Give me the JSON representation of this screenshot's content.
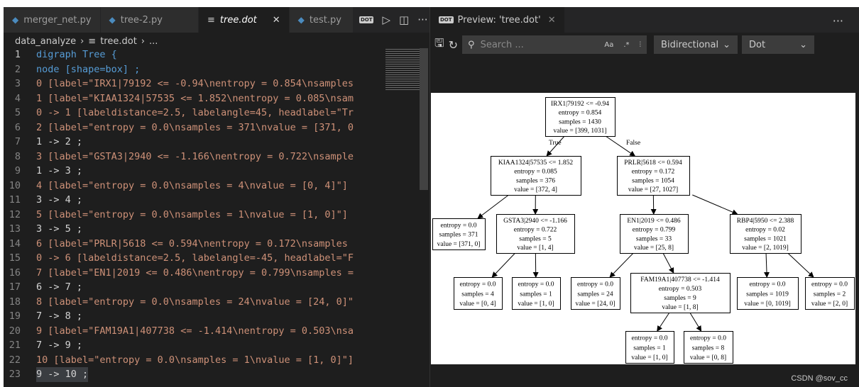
{
  "editor": {
    "tabs": [
      {
        "label": "merger_net.py",
        "icon": "python-icon"
      },
      {
        "label": "tree-2.py",
        "icon": "python-icon"
      },
      {
        "label": "tree.dot",
        "icon": "file-lines-icon",
        "active": true,
        "close": "✕"
      },
      {
        "label": "test.py",
        "icon": "python-icon"
      }
    ],
    "actions": {
      "dot_badge": "DOT",
      "run": "▷",
      "split": "◫",
      "more": "···"
    },
    "breadcrumb": [
      "data_analyze",
      "tree.dot",
      "..."
    ],
    "lines": [
      "digraph Tree {",
      "node [shape=box] ;",
      "0 [label=\"IRX1|79192 <= -0.94\\nentropy = 0.854\\nsamples",
      "1 [label=\"KIAA1324|57535 <= 1.852\\nentropy = 0.085\\nsam",
      "0 -> 1 [labeldistance=2.5, labelangle=45, headlabel=\"Tr",
      "2 [label=\"entropy = 0.0\\nsamples = 371\\nvalue = [371, 0",
      "1 -> 2 ;",
      "3 [label=\"GSTA3|2940 <= -1.166\\nentropy = 0.722\\nsample",
      "1 -> 3 ;",
      "4 [label=\"entropy = 0.0\\nsamples = 4\\nvalue = [0, 4]\"]",
      "3 -> 4 ;",
      "5 [label=\"entropy = 0.0\\nsamples = 1\\nvalue = [1, 0]\"]",
      "3 -> 5 ;",
      "6 [label=\"PRLR|5618 <= 0.594\\nentropy = 0.172\\nsamples",
      "0 -> 6 [labeldistance=2.5, labelangle=-45, headlabel=\"F",
      "7 [label=\"EN1|2019 <= 0.486\\nentropy = 0.799\\nsamples =",
      "6 -> 7 ;",
      "8 [label=\"entropy = 0.0\\nsamples = 24\\nvalue = [24, 0]\"",
      "7 -> 8 ;",
      "9 [label=\"FAM19A1|407738 <= -1.414\\nentropy = 0.503\\nsa",
      "7 -> 9 ;",
      "10 [label=\"entropy = 0.0\\nsamples = 1\\nvalue = [1, 0]\"]",
      "9 -> 10 ;"
    ]
  },
  "preview": {
    "tab_label": "Preview: 'tree.dot'",
    "close": "✕",
    "more": "···",
    "search_placeholder": "Search ...",
    "search_options": [
      "Aa",
      ".*",
      "⫶"
    ],
    "direction": "Bidirectional",
    "engine": "Dot",
    "edge_labels": {
      "true": "True",
      "false": "False"
    },
    "nodes": [
      {
        "id": 0,
        "lines": [
          "IRX1|79192 <= -0.94",
          "entropy = 0.854",
          "samples = 1430",
          "value = [399, 1031]"
        ]
      },
      {
        "id": 1,
        "lines": [
          "KIAA1324|57535 <= 1.852",
          "entropy = 0.085",
          "samples = 376",
          "value = [372, 4]"
        ]
      },
      {
        "id": 2,
        "lines": [
          "entropy = 0.0",
          "samples = 371",
          "value = [371, 0]"
        ]
      },
      {
        "id": 3,
        "lines": [
          "GSTA3|2940 <= -1.166",
          "entropy = 0.722",
          "samples = 5",
          "value = [1, 4]"
        ]
      },
      {
        "id": 4,
        "lines": [
          "entropy = 0.0",
          "samples = 4",
          "value = [0, 4]"
        ]
      },
      {
        "id": 5,
        "lines": [
          "entropy = 0.0",
          "samples = 1",
          "value = [1, 0]"
        ]
      },
      {
        "id": 6,
        "lines": [
          "PRLR|5618 <= 0.594",
          "entropy = 0.172",
          "samples = 1054",
          "value = [27, 1027]"
        ]
      },
      {
        "id": 7,
        "lines": [
          "EN1|2019 <= 0.486",
          "entropy = 0.799",
          "samples = 33",
          "value = [25, 8]"
        ]
      },
      {
        "id": 8,
        "lines": [
          "entropy = 0.0",
          "samples = 24",
          "value = [24, 0]"
        ]
      },
      {
        "id": 9,
        "lines": [
          "FAM19A1|407738 <= -1.414",
          "entropy = 0.503",
          "samples = 9",
          "value = [1, 8]"
        ]
      },
      {
        "id": 10,
        "lines": [
          "entropy = 0.0",
          "samples = 1",
          "value = [1, 0]"
        ]
      },
      {
        "id": 11,
        "lines": [
          "entropy = 0.0",
          "samples = 8",
          "value = [0, 8]"
        ]
      },
      {
        "id": 12,
        "lines": [
          "RBP4|5950 <= 2.388",
          "entropy = 0.02",
          "samples = 1021",
          "value = [2, 1019]"
        ]
      },
      {
        "id": 13,
        "lines": [
          "entropy = 0.0",
          "samples = 1019",
          "value = [0, 1019]"
        ]
      },
      {
        "id": 14,
        "lines": [
          "entropy = 0.0",
          "samples = 2",
          "value = [2, 0]"
        ]
      }
    ],
    "edges": [
      [
        0,
        1
      ],
      [
        1,
        2
      ],
      [
        1,
        3
      ],
      [
        3,
        4
      ],
      [
        3,
        5
      ],
      [
        0,
        6
      ],
      [
        6,
        7
      ],
      [
        7,
        8
      ],
      [
        7,
        9
      ],
      [
        9,
        10
      ],
      [
        9,
        11
      ],
      [
        6,
        12
      ],
      [
        12,
        13
      ],
      [
        12,
        14
      ]
    ]
  },
  "watermark": "CSDN @sov_cc"
}
